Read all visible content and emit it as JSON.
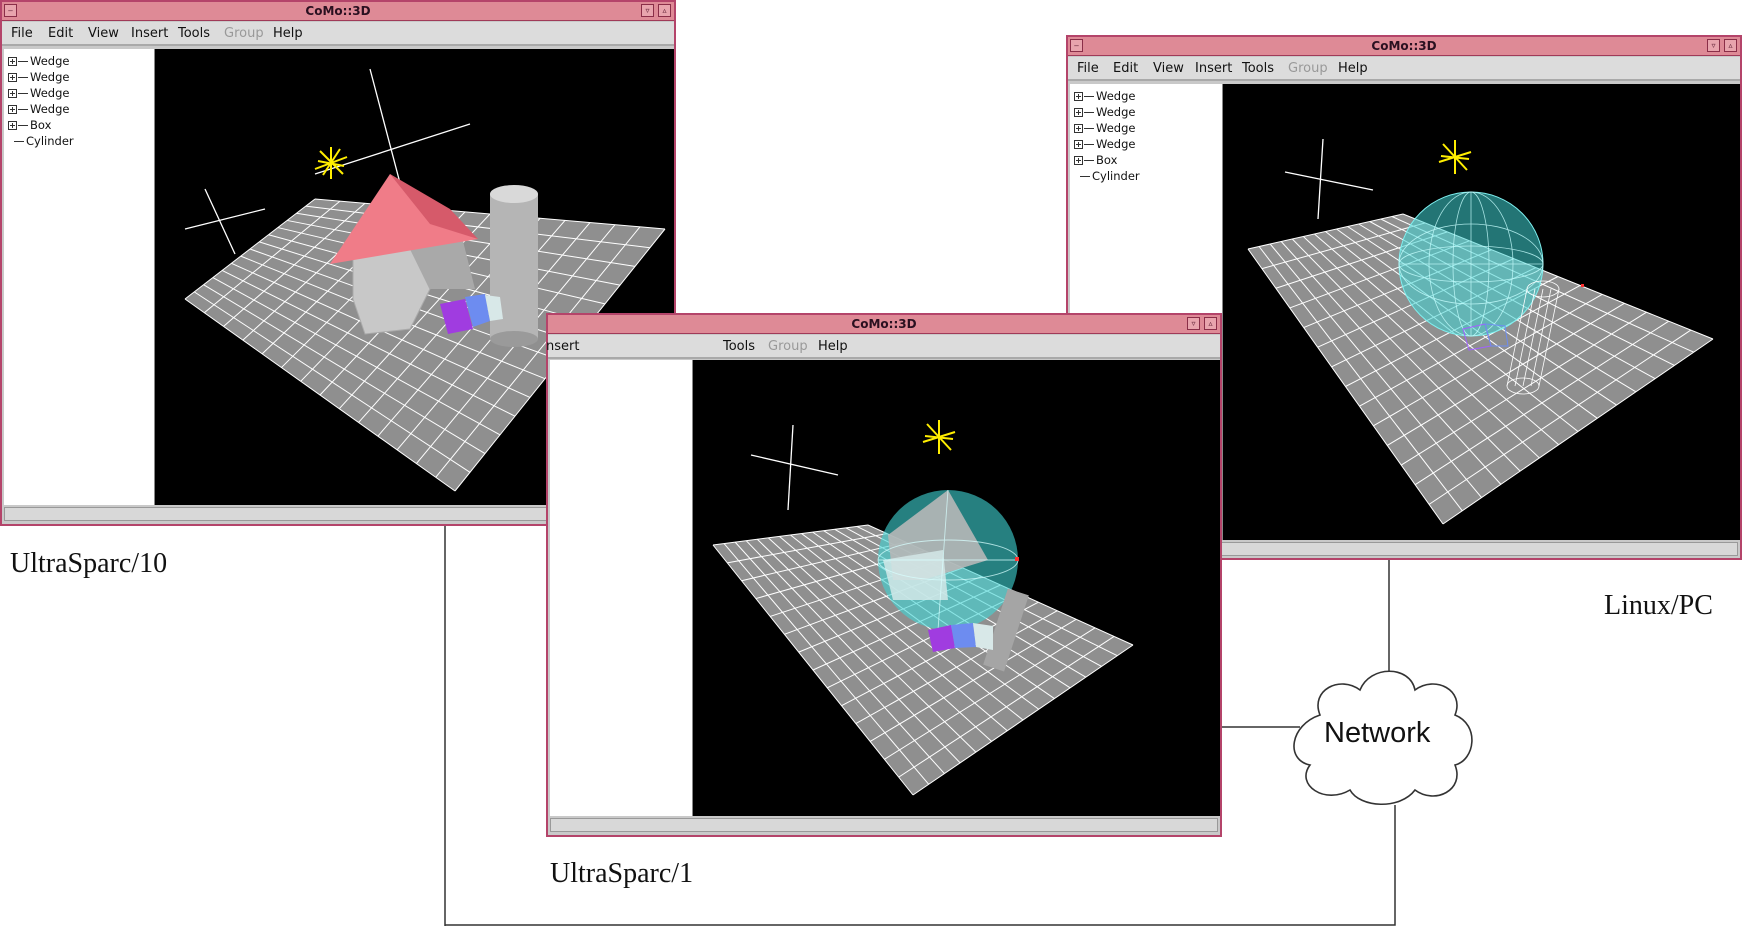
{
  "windows": {
    "us10": {
      "title": "CoMo::3D",
      "menu": [
        "File",
        "Edit",
        "View",
        "Insert",
        "Tools",
        "Group",
        "Help"
      ],
      "menu_disabled": "Group",
      "tree": [
        "Wedge",
        "Wedge",
        "Wedge",
        "Wedge",
        "Box",
        "Cylinder"
      ]
    },
    "us1": {
      "title": "CoMo::3D",
      "menu": [
        "nsert",
        "Tools",
        "Group",
        "Help"
      ],
      "menu_disabled": "Group"
    },
    "linux": {
      "title": "CoMo::3D",
      "menu": [
        "File",
        "Edit",
        "View",
        "Insert",
        "Tools",
        "Group",
        "Help"
      ],
      "menu_disabled": "Group",
      "tree": [
        "Wedge",
        "Wedge",
        "Wedge",
        "Wedge",
        "Box",
        "Cylinder"
      ]
    }
  },
  "labels": {
    "us10": "UltraSparc/10",
    "us1": "UltraSparc/1",
    "linux": "Linux/PC",
    "network": "Network"
  },
  "colors": {
    "window_border": "#b4446a",
    "titlebar": "#de8a96",
    "roof": "#f07c88",
    "sphere": "#3fd6d6",
    "light": "#ffee00"
  }
}
